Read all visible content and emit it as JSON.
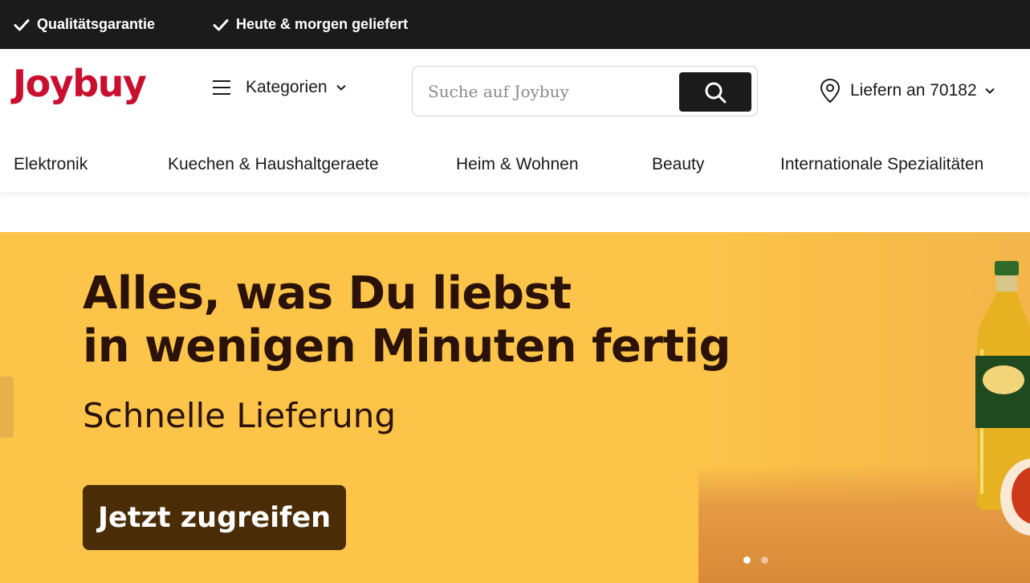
{
  "topbar": {
    "promos": [
      {
        "label": "Qualitätsgarantie",
        "icon": "check-icon"
      },
      {
        "label": "Heute & morgen geliefert",
        "icon": "check-icon"
      }
    ]
  },
  "header": {
    "logo": "Joybuy",
    "categories_label": "Kategorien",
    "search": {
      "placeholder": "Suche auf Joybuy",
      "value": ""
    },
    "deliver_label": "Liefern an 70182"
  },
  "nav": {
    "items": [
      "Elektronik",
      "Kuechen & Haushaltgeraete",
      "Heim & Wohnen",
      "Beauty",
      "Internationale Spezialitäten"
    ]
  },
  "hero": {
    "headline_line1": "Alles, was Du liebst",
    "headline_line2": "in wenigen Minuten fertig",
    "subtitle": "Schnelle Lieferung",
    "cta_label": "Jetzt zugreifen",
    "slides_total": 2,
    "active_slide": 1
  },
  "colors": {
    "brand": "#c8102e",
    "topbar_bg": "#1b1b1b",
    "hero_bg": "#fcc54a",
    "hero_text": "#2b1209",
    "cta_bg": "#4a2d07"
  }
}
